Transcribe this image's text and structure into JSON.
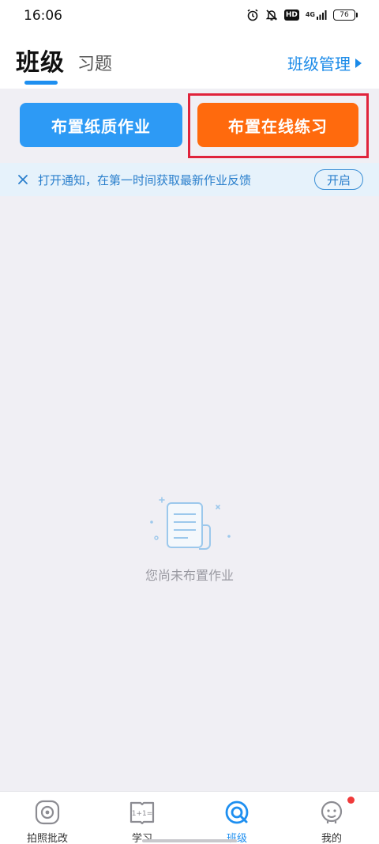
{
  "status_bar": {
    "time": "16:06",
    "hd": "HD",
    "network": "4G",
    "battery": "76",
    "icons": [
      "alarm-icon",
      "mute-bell-icon",
      "hd-badge",
      "signal-icon",
      "battery-icon"
    ]
  },
  "header": {
    "active_tab": "班级",
    "inactive_tab": "习题",
    "manage_link": "班级管理",
    "accent_color": "#1e8ff0"
  },
  "actions": {
    "paper_homework": "布置纸质作业",
    "online_practice": "布置在线练习",
    "paper_color": "#2d9af5",
    "online_color": "#ff6a0d",
    "highlight_color": "#e0233b"
  },
  "notice": {
    "text": "打开通知，在第一时间获取最新作业反馈",
    "button": "开启"
  },
  "empty_state": {
    "message": "您尚未布置作业",
    "icon": "document-icon"
  },
  "bottom_nav": {
    "items": [
      {
        "label": "拍照批改",
        "icon": "camera-icon",
        "active": false
      },
      {
        "label": "学习",
        "icon": "book-icon",
        "active": false
      },
      {
        "label": "班级",
        "icon": "class-icon",
        "active": true
      },
      {
        "label": "我的",
        "icon": "profile-icon",
        "active": false,
        "badge": true
      }
    ]
  }
}
